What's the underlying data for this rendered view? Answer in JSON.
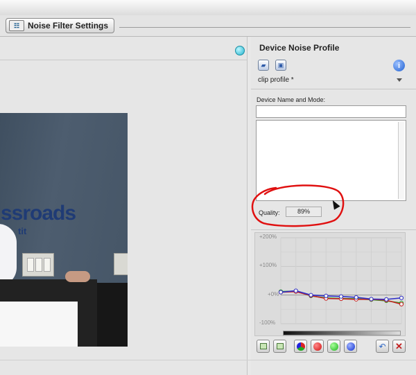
{
  "tab": {
    "label": "Noise Filter Settings",
    "icon": "sliders-icon"
  },
  "panel": {
    "title": "Device Noise Profile",
    "profile_select": "clip profile *",
    "device_label": "Device Name and Mode:",
    "device_value": "",
    "mode_text": "",
    "quality_label": "Quality:",
    "quality_value": "89%"
  },
  "graph": {
    "y_ticks": [
      "+200%",
      "+100%",
      "+0%",
      "-100%"
    ],
    "ylim": [
      -100,
      200
    ]
  },
  "chart_data": {
    "type": "line",
    "x": [
      1,
      2,
      3,
      4,
      5,
      6,
      7,
      8,
      9
    ],
    "ylim": [
      -100,
      200
    ],
    "grid": true,
    "series": [
      {
        "color": "#3030c8",
        "values": [
          10,
          15,
          0,
          -3,
          -5,
          -8,
          -14,
          -15,
          -10
        ]
      },
      {
        "color": "#c82020",
        "values": [
          10,
          12,
          -2,
          -12,
          -13,
          -15,
          -15,
          -18,
          -32
        ]
      },
      {
        "color": "#20a020",
        "values": [
          12,
          14,
          -3,
          -10,
          -12,
          -13,
          -16,
          -20,
          -28
        ]
      }
    ]
  },
  "colors": {
    "accent": "#22b5cf",
    "annotation": "#e01010",
    "panel_bg": "#e6e6e6"
  },
  "photo": {
    "sign_text": "ssroads",
    "sign_subtext": "tit"
  }
}
